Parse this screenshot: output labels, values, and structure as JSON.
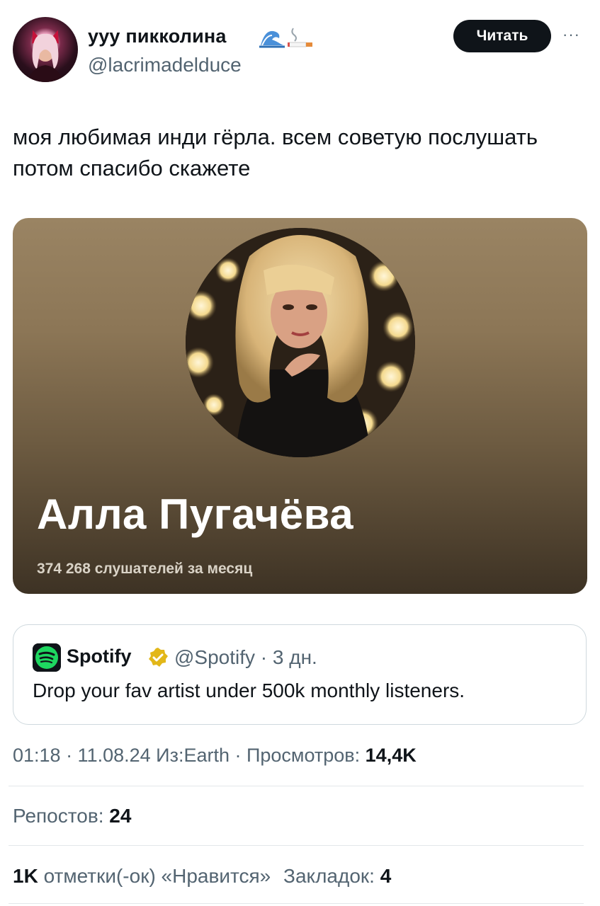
{
  "author": {
    "display_name": "ууу пикколина",
    "emoji_icons": [
      "water-wave-icon",
      "cigarette-icon"
    ],
    "handle": "@lacrimadelduce"
  },
  "follow_button": "Читать",
  "more_icon": "more-dots-icon",
  "tweet_text": "моя любимая инди гёрла. всем советую послушать потом спасибо скажете",
  "media_card": {
    "artist_name": "Алла Пугачёва",
    "listeners": "374 268 слушателей за месяц"
  },
  "quote": {
    "logo_icon": "spotify-icon",
    "name": "Spotify",
    "verified_icon": "verified-gold-badge-icon",
    "meta": "@Spotify · 3 дн.",
    "text": "Drop your fav artist under 500k monthly listeners."
  },
  "timestamp": {
    "time": "01:18 · 11.08.24 Из:Earth · Просмотров:",
    "views": "14,4K"
  },
  "stats": {
    "reposts_label": "Репостов:",
    "reposts_value": "24",
    "likes_value": "1K",
    "likes_label": "отметки(-ок) «Нравится»",
    "bookmarks_label": "Закладок:",
    "bookmarks_value": "4"
  },
  "colors": {
    "text_primary": "#0f1419",
    "text_secondary": "#536471",
    "border": "#cfd9de",
    "spotify_green": "#1ed760",
    "verified_gold": "#e2b719"
  }
}
